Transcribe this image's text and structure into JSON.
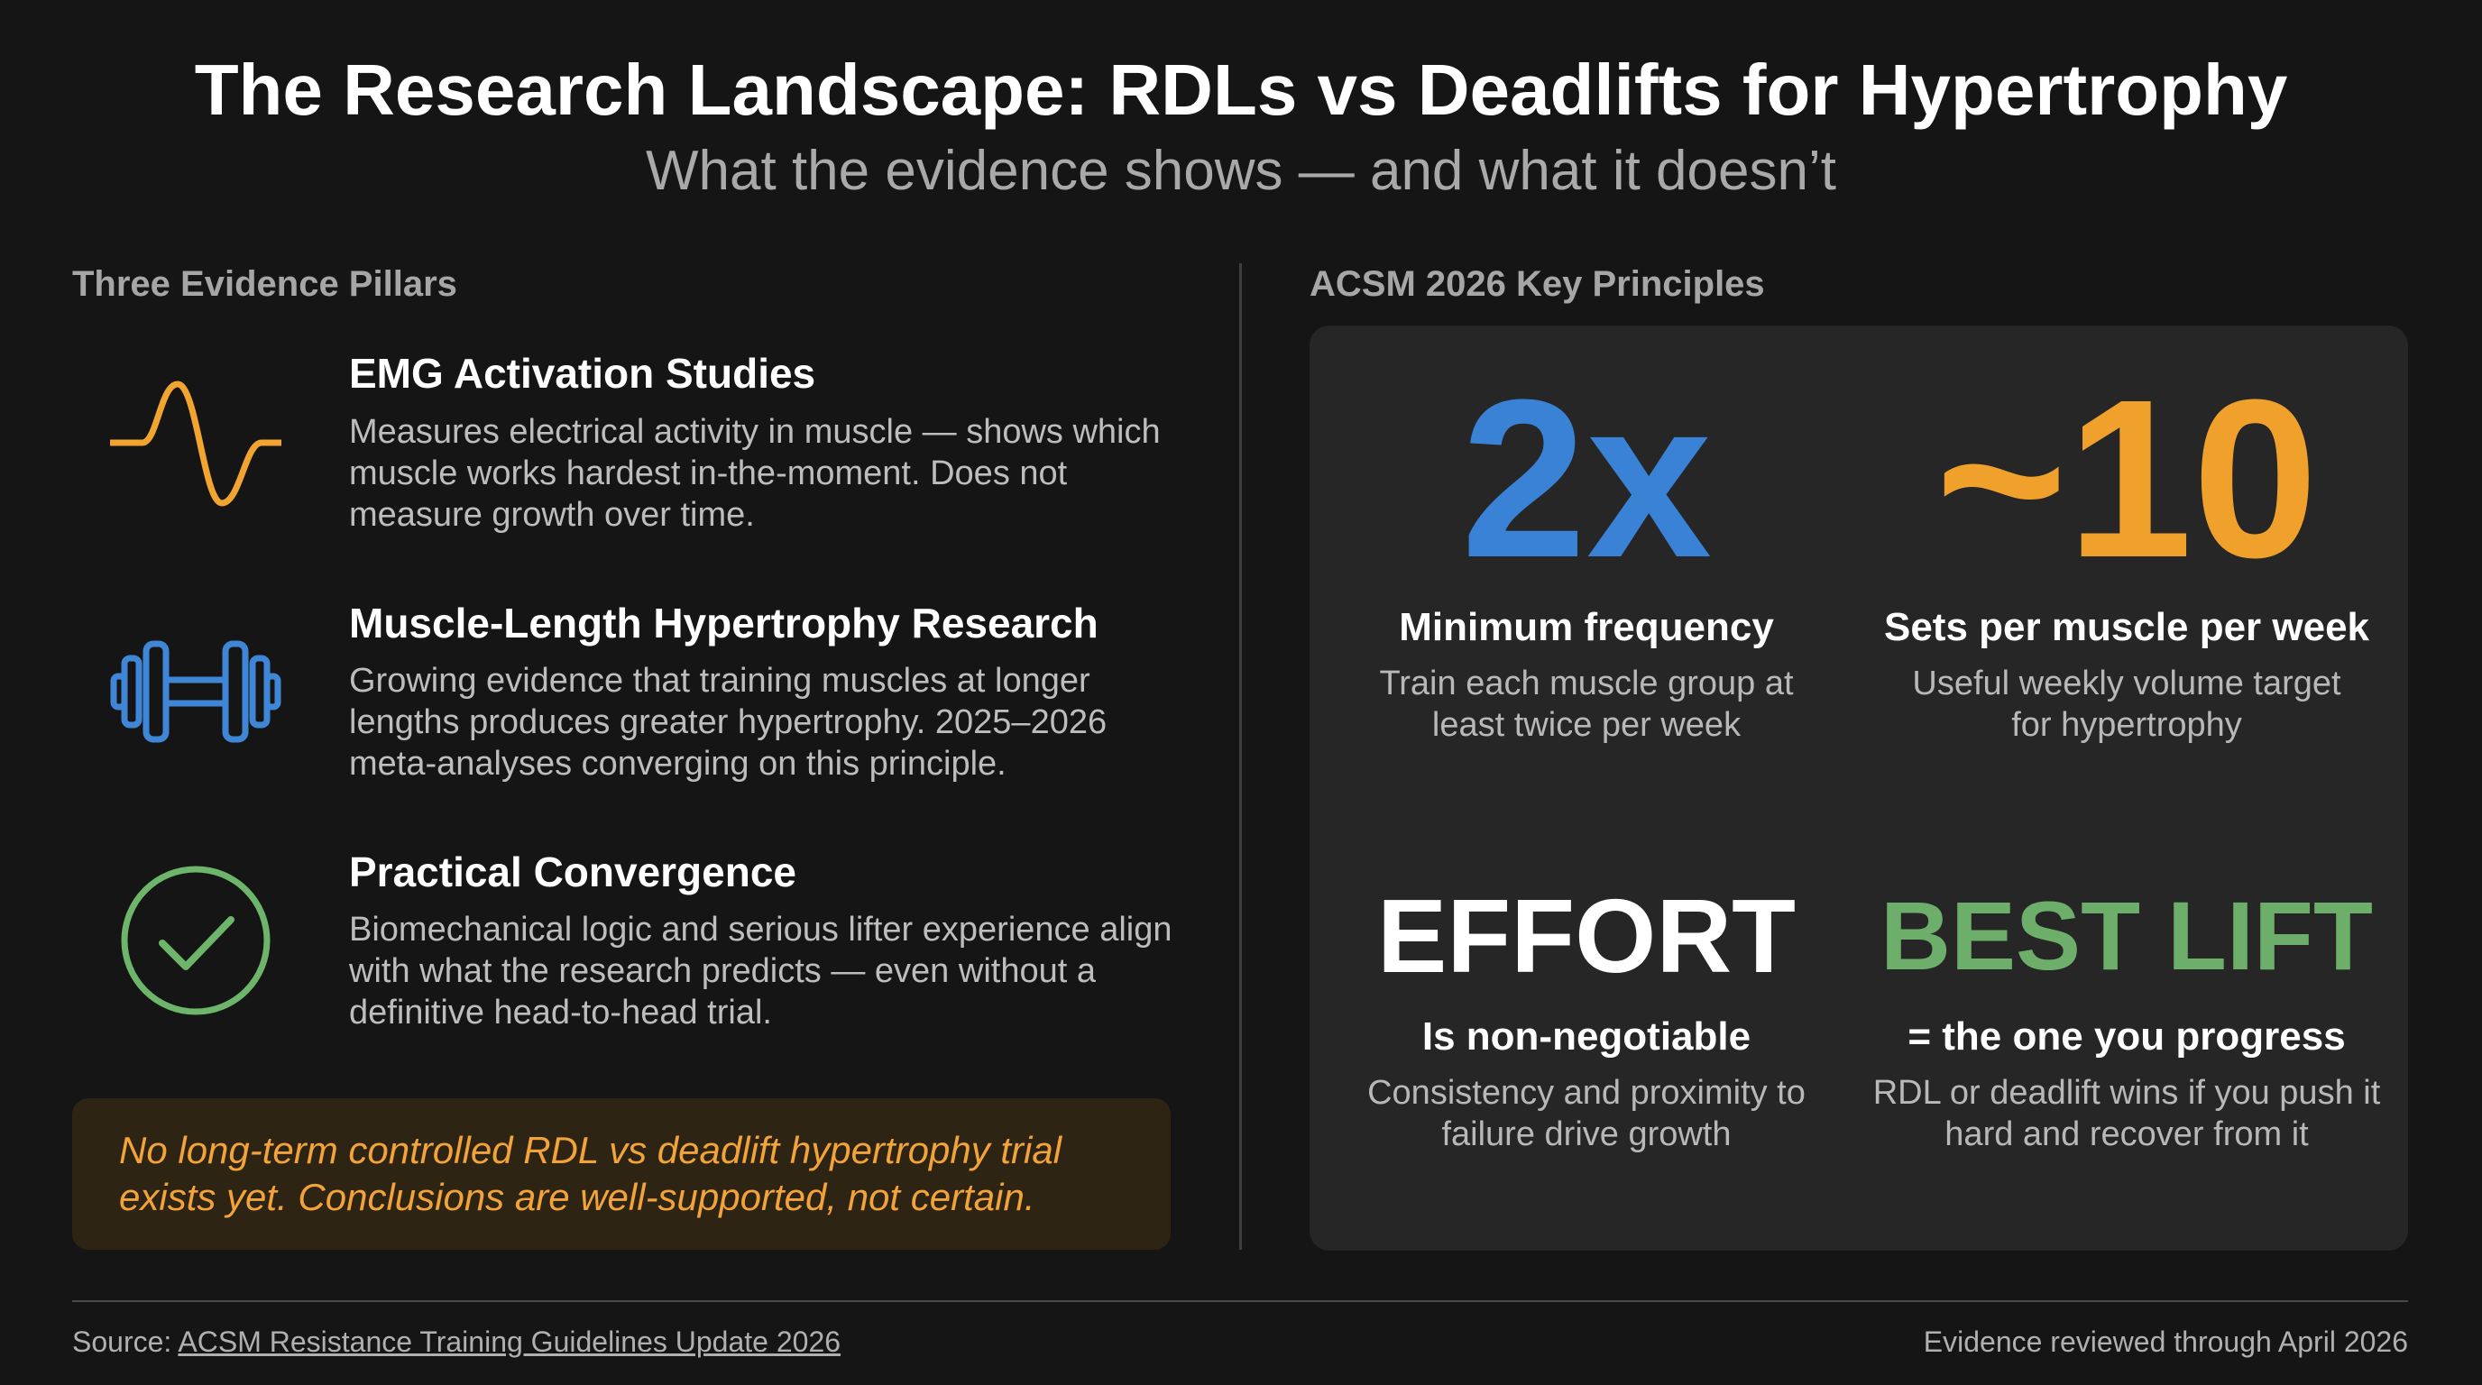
{
  "header": {
    "title": "The Research Landscape: RDLs vs Deadlifts for Hypertrophy",
    "subtitle": "What the evidence shows — and what it doesn’t"
  },
  "pillars": {
    "heading": "Three Evidence Pillars",
    "items": [
      {
        "icon": "waveform-icon",
        "title": "EMG Activation Studies",
        "description": "Measures electrical activity in muscle — shows which muscle works hardest in-the-moment. Does not measure growth over time.",
        "color": "#f2a431"
      },
      {
        "icon": "dumbbell-icon",
        "title": "Muscle-Length Hypertrophy Research",
        "description": "Growing evidence that training muscles at longer lengths produces greater hypertrophy. 2025–2026 meta-analyses converging on this principle.",
        "color": "#3f86d6"
      },
      {
        "icon": "checkmark-circle-icon",
        "title": "Practical Convergence",
        "description": "Biomechanical logic and serious lifter experience align with what the research predicts — even without a definitive head-to-head trial.",
        "color": "#6db56a"
      }
    ],
    "callout": "No long-term controlled RDL vs deadlift hypertrophy trial exists yet. Conclusions are well-supported, not certain."
  },
  "principles": {
    "heading": "ACSM 2026 Key Principles",
    "items": [
      {
        "value": "2x",
        "label": "Minimum frequency",
        "description": "Train each muscle group at least twice per week",
        "color": "#3a82d6"
      },
      {
        "value": "~10",
        "label": "Sets per muscle per week",
        "description": "Useful weekly volume target for hypertrophy",
        "color": "#f0a12b"
      },
      {
        "value": "EFFORT",
        "label": "Is non-negotiable",
        "description": "Consistency and proximity to failure drive growth",
        "color": "#ffffff"
      },
      {
        "value": "BEST LIFT",
        "label": "= the one you progress",
        "description": "RDL or deadlift wins if you push it hard and recover from it",
        "color": "#6daf6a"
      }
    ]
  },
  "footer": {
    "source_prefix": "Source: ",
    "source_link": "ACSM Resistance Training Guidelines Update 2026",
    "reviewed": "Evidence reviewed through April 2026"
  }
}
